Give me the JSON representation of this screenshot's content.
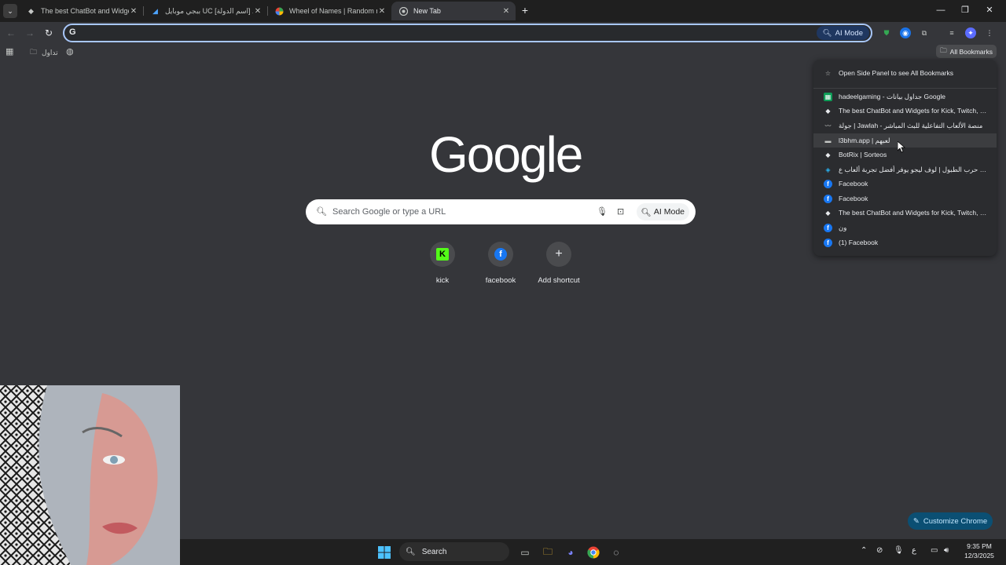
{
  "tabs": [
    {
      "title": "The best ChatBot and Widgets",
      "icon": "diamond-icon"
    },
    {
      "title": "ببجي موبايل UC [اسم الدولة] خد",
      "icon": "pubg-icon"
    },
    {
      "title": "Wheel of Names | Random nam",
      "icon": "wheel-icon"
    },
    {
      "title": "New Tab",
      "icon": "chrome-icon"
    }
  ],
  "toolbar": {
    "omnibox_value": "",
    "ai_mode_label": "AI Mode"
  },
  "bookmarks_bar": {
    "folder_label": "تداول",
    "all_bookmarks_label": "All Bookmarks"
  },
  "ntp": {
    "logo_text": "Google",
    "search_placeholder": "Search Google or type a URL",
    "ai_mode_label": "AI Mode",
    "shortcuts": [
      {
        "label": "kick"
      },
      {
        "label": "facebook"
      },
      {
        "label": "Add shortcut"
      }
    ],
    "customize_label": "Customize Chrome"
  },
  "bookmarks_menu": {
    "open_side_panel": "Open Side Panel to see All Bookmarks",
    "items": [
      {
        "title": "hadeelgaming - جداول بيانات Google",
        "icon": "sheets-icon"
      },
      {
        "title": "The best ChatBot and Widgets for Kick, Twitch, YouT...",
        "icon": "diamond-icon"
      },
      {
        "title": "جولة | Jawlah - منصة الألعاب التفاعلية للبث المباشر",
        "icon": "jawlah-icon"
      },
      {
        "title": "l3bhm.app | لعبهم",
        "icon": "l3bhm-icon"
      },
      {
        "title": "BotRix | Sorteos",
        "icon": "diamond-icon"
      },
      {
        "title": "لعبة حرب الطبول | لوف ليجو يوفر أفضل تجربة ألعاب ع...",
        "icon": "game-icon"
      },
      {
        "title": "Facebook",
        "icon": "facebook-icon"
      },
      {
        "title": "Facebook",
        "icon": "facebook-icon"
      },
      {
        "title": "The best ChatBot and Widgets for Kick, Twitch, YouT...",
        "icon": "diamond-icon"
      },
      {
        "title": "ون",
        "icon": "facebook-icon"
      },
      {
        "title": "(1) Facebook",
        "icon": "facebook-icon"
      }
    ]
  },
  "taskbar": {
    "search_label": "Search",
    "lang": "ع",
    "time": "9:35 PM",
    "date": "12/3/2025"
  },
  "colors": {
    "omnibox_focus": "#a8c7fa",
    "customize_bg": "#0b4f73",
    "page_bg": "#35363a"
  }
}
